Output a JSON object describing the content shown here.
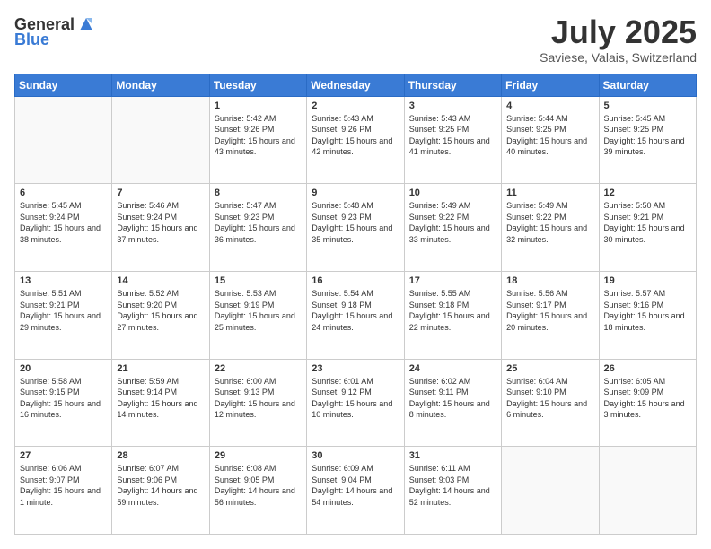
{
  "header": {
    "logo_line1": "General",
    "logo_line2": "Blue",
    "title": "July 2025",
    "location": "Saviese, Valais, Switzerland"
  },
  "weekdays": [
    "Sunday",
    "Monday",
    "Tuesday",
    "Wednesday",
    "Thursday",
    "Friday",
    "Saturday"
  ],
  "weeks": [
    [
      {
        "day": "",
        "sunrise": "",
        "sunset": "",
        "daylight": ""
      },
      {
        "day": "",
        "sunrise": "",
        "sunset": "",
        "daylight": ""
      },
      {
        "day": "1",
        "sunrise": "Sunrise: 5:42 AM",
        "sunset": "Sunset: 9:26 PM",
        "daylight": "Daylight: 15 hours and 43 minutes."
      },
      {
        "day": "2",
        "sunrise": "Sunrise: 5:43 AM",
        "sunset": "Sunset: 9:26 PM",
        "daylight": "Daylight: 15 hours and 42 minutes."
      },
      {
        "day": "3",
        "sunrise": "Sunrise: 5:43 AM",
        "sunset": "Sunset: 9:25 PM",
        "daylight": "Daylight: 15 hours and 41 minutes."
      },
      {
        "day": "4",
        "sunrise": "Sunrise: 5:44 AM",
        "sunset": "Sunset: 9:25 PM",
        "daylight": "Daylight: 15 hours and 40 minutes."
      },
      {
        "day": "5",
        "sunrise": "Sunrise: 5:45 AM",
        "sunset": "Sunset: 9:25 PM",
        "daylight": "Daylight: 15 hours and 39 minutes."
      }
    ],
    [
      {
        "day": "6",
        "sunrise": "Sunrise: 5:45 AM",
        "sunset": "Sunset: 9:24 PM",
        "daylight": "Daylight: 15 hours and 38 minutes."
      },
      {
        "day": "7",
        "sunrise": "Sunrise: 5:46 AM",
        "sunset": "Sunset: 9:24 PM",
        "daylight": "Daylight: 15 hours and 37 minutes."
      },
      {
        "day": "8",
        "sunrise": "Sunrise: 5:47 AM",
        "sunset": "Sunset: 9:23 PM",
        "daylight": "Daylight: 15 hours and 36 minutes."
      },
      {
        "day": "9",
        "sunrise": "Sunrise: 5:48 AM",
        "sunset": "Sunset: 9:23 PM",
        "daylight": "Daylight: 15 hours and 35 minutes."
      },
      {
        "day": "10",
        "sunrise": "Sunrise: 5:49 AM",
        "sunset": "Sunset: 9:22 PM",
        "daylight": "Daylight: 15 hours and 33 minutes."
      },
      {
        "day": "11",
        "sunrise": "Sunrise: 5:49 AM",
        "sunset": "Sunset: 9:22 PM",
        "daylight": "Daylight: 15 hours and 32 minutes."
      },
      {
        "day": "12",
        "sunrise": "Sunrise: 5:50 AM",
        "sunset": "Sunset: 9:21 PM",
        "daylight": "Daylight: 15 hours and 30 minutes."
      }
    ],
    [
      {
        "day": "13",
        "sunrise": "Sunrise: 5:51 AM",
        "sunset": "Sunset: 9:21 PM",
        "daylight": "Daylight: 15 hours and 29 minutes."
      },
      {
        "day": "14",
        "sunrise": "Sunrise: 5:52 AM",
        "sunset": "Sunset: 9:20 PM",
        "daylight": "Daylight: 15 hours and 27 minutes."
      },
      {
        "day": "15",
        "sunrise": "Sunrise: 5:53 AM",
        "sunset": "Sunset: 9:19 PM",
        "daylight": "Daylight: 15 hours and 25 minutes."
      },
      {
        "day": "16",
        "sunrise": "Sunrise: 5:54 AM",
        "sunset": "Sunset: 9:18 PM",
        "daylight": "Daylight: 15 hours and 24 minutes."
      },
      {
        "day": "17",
        "sunrise": "Sunrise: 5:55 AM",
        "sunset": "Sunset: 9:18 PM",
        "daylight": "Daylight: 15 hours and 22 minutes."
      },
      {
        "day": "18",
        "sunrise": "Sunrise: 5:56 AM",
        "sunset": "Sunset: 9:17 PM",
        "daylight": "Daylight: 15 hours and 20 minutes."
      },
      {
        "day": "19",
        "sunrise": "Sunrise: 5:57 AM",
        "sunset": "Sunset: 9:16 PM",
        "daylight": "Daylight: 15 hours and 18 minutes."
      }
    ],
    [
      {
        "day": "20",
        "sunrise": "Sunrise: 5:58 AM",
        "sunset": "Sunset: 9:15 PM",
        "daylight": "Daylight: 15 hours and 16 minutes."
      },
      {
        "day": "21",
        "sunrise": "Sunrise: 5:59 AM",
        "sunset": "Sunset: 9:14 PM",
        "daylight": "Daylight: 15 hours and 14 minutes."
      },
      {
        "day": "22",
        "sunrise": "Sunrise: 6:00 AM",
        "sunset": "Sunset: 9:13 PM",
        "daylight": "Daylight: 15 hours and 12 minutes."
      },
      {
        "day": "23",
        "sunrise": "Sunrise: 6:01 AM",
        "sunset": "Sunset: 9:12 PM",
        "daylight": "Daylight: 15 hours and 10 minutes."
      },
      {
        "day": "24",
        "sunrise": "Sunrise: 6:02 AM",
        "sunset": "Sunset: 9:11 PM",
        "daylight": "Daylight: 15 hours and 8 minutes."
      },
      {
        "day": "25",
        "sunrise": "Sunrise: 6:04 AM",
        "sunset": "Sunset: 9:10 PM",
        "daylight": "Daylight: 15 hours and 6 minutes."
      },
      {
        "day": "26",
        "sunrise": "Sunrise: 6:05 AM",
        "sunset": "Sunset: 9:09 PM",
        "daylight": "Daylight: 15 hours and 3 minutes."
      }
    ],
    [
      {
        "day": "27",
        "sunrise": "Sunrise: 6:06 AM",
        "sunset": "Sunset: 9:07 PM",
        "daylight": "Daylight: 15 hours and 1 minute."
      },
      {
        "day": "28",
        "sunrise": "Sunrise: 6:07 AM",
        "sunset": "Sunset: 9:06 PM",
        "daylight": "Daylight: 14 hours and 59 minutes."
      },
      {
        "day": "29",
        "sunrise": "Sunrise: 6:08 AM",
        "sunset": "Sunset: 9:05 PM",
        "daylight": "Daylight: 14 hours and 56 minutes."
      },
      {
        "day": "30",
        "sunrise": "Sunrise: 6:09 AM",
        "sunset": "Sunset: 9:04 PM",
        "daylight": "Daylight: 14 hours and 54 minutes."
      },
      {
        "day": "31",
        "sunrise": "Sunrise: 6:11 AM",
        "sunset": "Sunset: 9:03 PM",
        "daylight": "Daylight: 14 hours and 52 minutes."
      },
      {
        "day": "",
        "sunrise": "",
        "sunset": "",
        "daylight": ""
      },
      {
        "day": "",
        "sunrise": "",
        "sunset": "",
        "daylight": ""
      }
    ]
  ]
}
